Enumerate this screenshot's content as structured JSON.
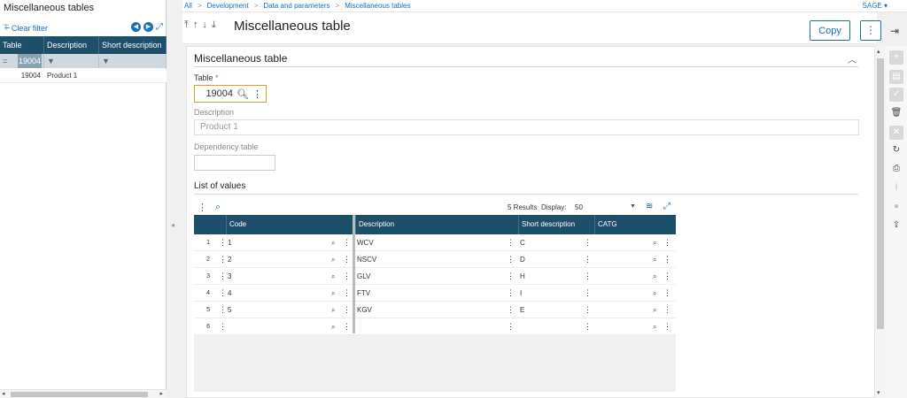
{
  "left_panel": {
    "title": "Miscellaneous tables",
    "clear_filter": "Clear filter",
    "columns": [
      "Table",
      "Description",
      "Short description"
    ],
    "filter_value": "19004",
    "rows": [
      {
        "table": "19004",
        "description": "Product 1"
      }
    ]
  },
  "breadcrumb": [
    "All",
    "Development",
    "Data and parameters",
    "Miscellaneous tables"
  ],
  "user_menu": "SAGE",
  "header": {
    "title": "Miscellaneous table",
    "copy_label": "Copy",
    "more_glyph": "⋮",
    "arrows": [
      "⤒",
      "↑",
      "↓",
      "⤓"
    ]
  },
  "form": {
    "section_title": "Miscellaneous table",
    "table_label": "Table",
    "table_required": "*",
    "table_value": "19004",
    "description_label": "Description",
    "description_value": "Product 1",
    "dependency_label": "Dependency table",
    "dependency_value": "",
    "list_title": "List of values"
  },
  "grid": {
    "results_text": "5 Results",
    "display_label": "Display:",
    "display_value": "50",
    "columns": [
      "Code",
      "Description",
      "Short description",
      "CATG"
    ],
    "rows": [
      {
        "n": "1",
        "code": "1",
        "description": "WCV",
        "short": "C",
        "catg": ""
      },
      {
        "n": "2",
        "code": "2",
        "description": "NSCV",
        "short": "D",
        "catg": ""
      },
      {
        "n": "3",
        "code": "3",
        "description": "GLV",
        "short": "H",
        "catg": ""
      },
      {
        "n": "4",
        "code": "4",
        "description": "FTV",
        "short": "I",
        "catg": ""
      },
      {
        "n": "5",
        "code": "5",
        "description": "KGV",
        "short": "E",
        "catg": ""
      },
      {
        "n": "6",
        "code": "",
        "description": "",
        "short": "",
        "catg": ""
      }
    ]
  },
  "colors": {
    "accent": "#1b6fb8",
    "grid_header": "#1d4f6b",
    "required": "#e04a2f",
    "focus_border": "#d9a030"
  }
}
